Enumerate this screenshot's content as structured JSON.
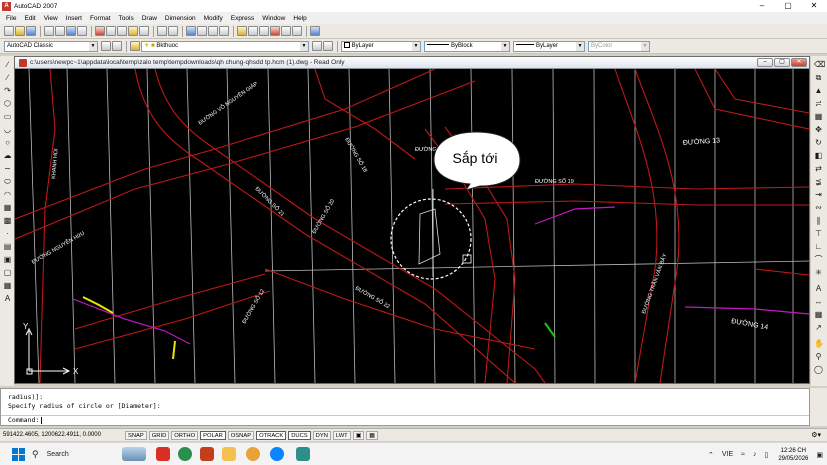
{
  "app": {
    "title": "AutoCAD 2007",
    "window_buttons": [
      "–",
      "▢",
      "✕"
    ]
  },
  "menu": [
    "File",
    "Edit",
    "View",
    "Insert",
    "Format",
    "Tools",
    "Draw",
    "Dimension",
    "Modify",
    "Express",
    "Window",
    "Help"
  ],
  "toolbar2": {
    "workspace": "AutoCAD Classic",
    "layer": "Bkthuoc",
    "color": "ByLayer",
    "linetype": "ByBlock",
    "lineweight": "ByLayer",
    "plotstyle": "ByColor"
  },
  "drawing": {
    "title": "c:\\users\\newpc~1\\appdata\\local\\temp\\zalo temp\\tempdownloads\\qh chung-qhsdd tp.hcm (1).dwg - Read Only",
    "ucs_x": "X",
    "ucs_y": "Y",
    "street_labels": [
      "ĐƯỜNG 13",
      "ĐƯỜNG 14",
      "ĐƯỜNG SỐ 19",
      "ĐƯỜNG SỐ 18",
      "ĐƯỜNG SỐ 21",
      "ĐƯỜNG SỐ 20",
      "ĐƯỜNG SỐ 8",
      "ĐƯỜNG SỐ 12",
      "ĐƯỜNG SỐ 22",
      "ĐƯỜNG VÕ NGUYÊN GIÁP",
      "ĐƯỜNG TRẦN VĂN BẢY",
      "KHANH HOI",
      "ĐƯỜNG NGUYỄN HữU"
    ]
  },
  "bubble_text": "Sắp tới",
  "command": {
    "lines": [
      "radius)]:",
      "Specify radius of circle or [Diameter]:"
    ],
    "prompt": "Command:"
  },
  "status": {
    "coords": "591422.4605, 1200622.4911, 0.0000",
    "buttons": [
      {
        "label": "SNAP",
        "on": false
      },
      {
        "label": "GRID",
        "on": false
      },
      {
        "label": "ORTHO",
        "on": false
      },
      {
        "label": "POLAR",
        "on": true
      },
      {
        "label": "OSNAP",
        "on": false
      },
      {
        "label": "OTRACK",
        "on": true
      },
      {
        "label": "DUCS",
        "on": true
      },
      {
        "label": "DYN",
        "on": false
      },
      {
        "label": "LWT",
        "on": false
      }
    ]
  },
  "taskbar": {
    "search": "Search",
    "lang": "VIE",
    "time": "12:26 CH",
    "date": "29/05/2026"
  },
  "colors": {
    "accent": "#0078d4",
    "road_red": "#c01818",
    "grid_white": "#dcdcdc",
    "magenta": "#c418c4",
    "yellow": "#e6e600"
  }
}
